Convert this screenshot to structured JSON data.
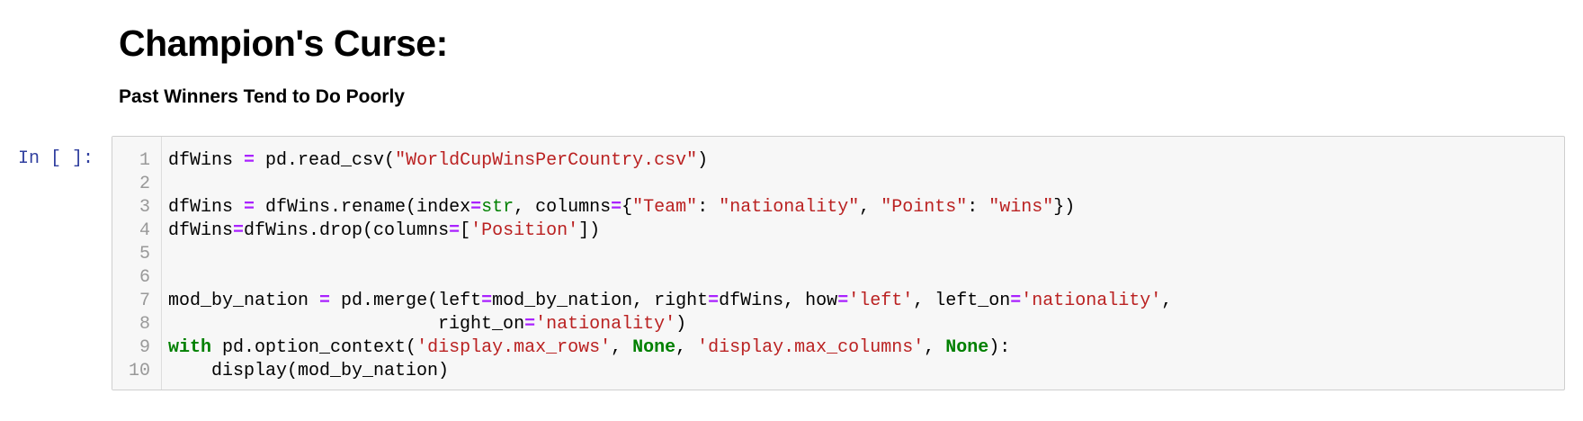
{
  "markdown": {
    "title": "Champion's Curse:",
    "subtitle": "Past Winners Tend to Do Poorly"
  },
  "cell": {
    "prompt": "In [ ]:",
    "lines": [
      {
        "num": "1",
        "tokens": [
          {
            "t": "dfWins ",
            "c": "n"
          },
          {
            "t": "=",
            "c": "op"
          },
          {
            "t": " pd.read_csv(",
            "c": "n"
          },
          {
            "t": "\"WorldCupWinsPerCountry.csv\"",
            "c": "str"
          },
          {
            "t": ")",
            "c": "n"
          }
        ]
      },
      {
        "num": "2",
        "tokens": []
      },
      {
        "num": "3",
        "tokens": [
          {
            "t": "dfWins ",
            "c": "n"
          },
          {
            "t": "=",
            "c": "op"
          },
          {
            "t": " dfWins.rename(index",
            "c": "n"
          },
          {
            "t": "=",
            "c": "op"
          },
          {
            "t": "str",
            "c": "bi"
          },
          {
            "t": ", columns",
            "c": "n"
          },
          {
            "t": "=",
            "c": "op"
          },
          {
            "t": "{",
            "c": "n"
          },
          {
            "t": "\"Team\"",
            "c": "str"
          },
          {
            "t": ": ",
            "c": "n"
          },
          {
            "t": "\"nationality\"",
            "c": "str"
          },
          {
            "t": ", ",
            "c": "n"
          },
          {
            "t": "\"Points\"",
            "c": "str"
          },
          {
            "t": ": ",
            "c": "n"
          },
          {
            "t": "\"wins\"",
            "c": "str"
          },
          {
            "t": "})",
            "c": "n"
          }
        ]
      },
      {
        "num": "4",
        "tokens": [
          {
            "t": "dfWins",
            "c": "n"
          },
          {
            "t": "=",
            "c": "op"
          },
          {
            "t": "dfWins.drop(columns",
            "c": "n"
          },
          {
            "t": "=",
            "c": "op"
          },
          {
            "t": "[",
            "c": "n"
          },
          {
            "t": "'Position'",
            "c": "str"
          },
          {
            "t": "])",
            "c": "n"
          }
        ]
      },
      {
        "num": "5",
        "tokens": []
      },
      {
        "num": "6",
        "tokens": []
      },
      {
        "num": "7",
        "tokens": [
          {
            "t": "mod_by_nation ",
            "c": "n"
          },
          {
            "t": "=",
            "c": "op"
          },
          {
            "t": " pd.merge(left",
            "c": "n"
          },
          {
            "t": "=",
            "c": "op"
          },
          {
            "t": "mod_by_nation, right",
            "c": "n"
          },
          {
            "t": "=",
            "c": "op"
          },
          {
            "t": "dfWins, how",
            "c": "n"
          },
          {
            "t": "=",
            "c": "op"
          },
          {
            "t": "'left'",
            "c": "str"
          },
          {
            "t": ", left_on",
            "c": "n"
          },
          {
            "t": "=",
            "c": "op"
          },
          {
            "t": "'nationality'",
            "c": "str"
          },
          {
            "t": ",",
            "c": "n"
          }
        ]
      },
      {
        "num": "8",
        "tokens": [
          {
            "t": "                         right_on",
            "c": "n"
          },
          {
            "t": "=",
            "c": "op"
          },
          {
            "t": "'nationality'",
            "c": "str"
          },
          {
            "t": ")",
            "c": "n"
          }
        ]
      },
      {
        "num": "9",
        "tokens": [
          {
            "t": "with",
            "c": "kw"
          },
          {
            "t": " pd.option_context(",
            "c": "n"
          },
          {
            "t": "'display.max_rows'",
            "c": "str"
          },
          {
            "t": ", ",
            "c": "n"
          },
          {
            "t": "None",
            "c": "kw"
          },
          {
            "t": ", ",
            "c": "n"
          },
          {
            "t": "'display.max_columns'",
            "c": "str"
          },
          {
            "t": ", ",
            "c": "n"
          },
          {
            "t": "None",
            "c": "kw"
          },
          {
            "t": "):",
            "c": "n"
          }
        ]
      },
      {
        "num": "10",
        "tokens": [
          {
            "t": "    display(mod_by_nation)",
            "c": "n"
          }
        ]
      }
    ]
  }
}
